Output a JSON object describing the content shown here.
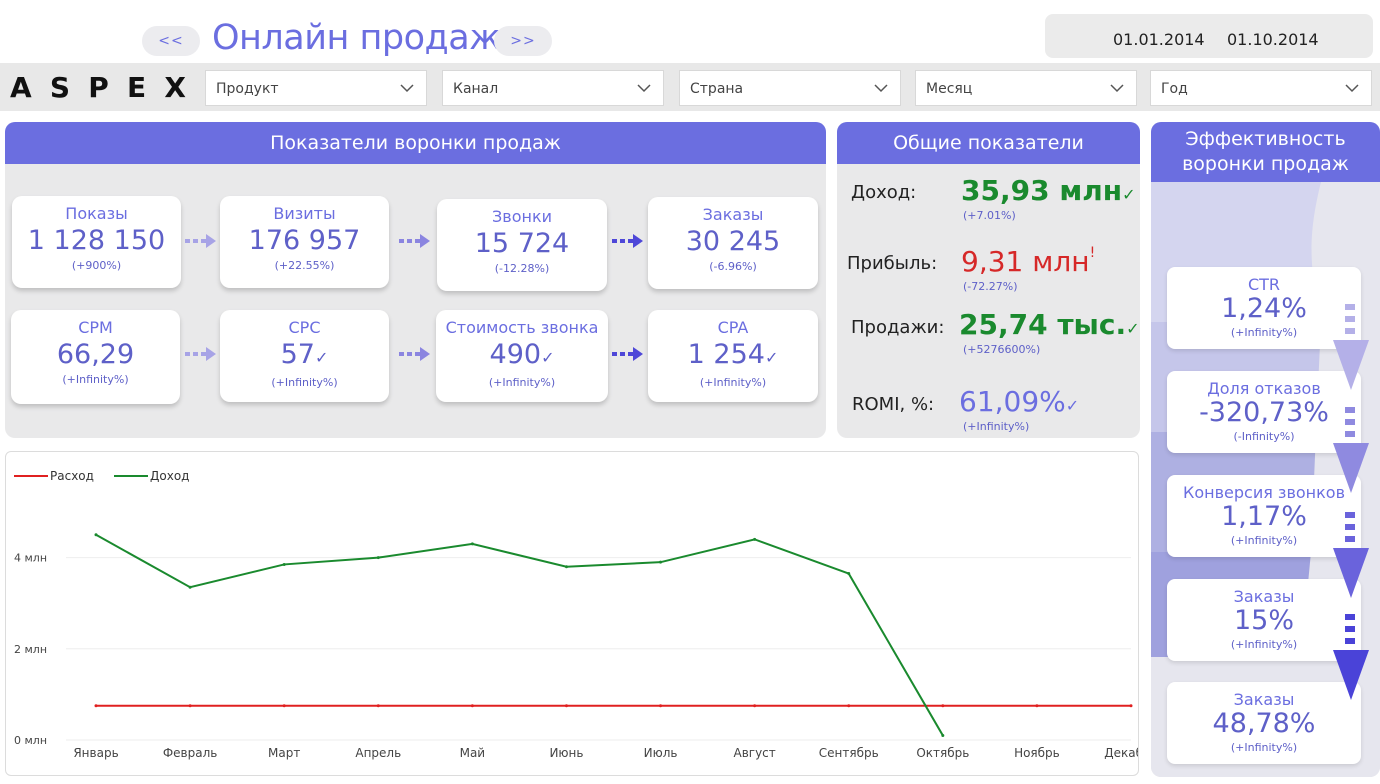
{
  "header": {
    "prev_label": "<<",
    "next_label": ">>",
    "title": "Онлайн продажи",
    "date_from": "01.01.2014",
    "date_to": "01.10.2014",
    "logo_text": "ASPEX"
  },
  "filters": [
    {
      "label": "Продукт"
    },
    {
      "label": "Канал"
    },
    {
      "label": "Страна"
    },
    {
      "label": "Месяц"
    },
    {
      "label": "Год"
    }
  ],
  "funnel": {
    "title": "Показатели воронки продаж",
    "cards": [
      {
        "label": "Показы",
        "value": "1 128 150",
        "change": "(+900%)"
      },
      {
        "label": "Визиты",
        "value": "176 957",
        "change": "(+22.55%)"
      },
      {
        "label": "Звонки",
        "value": "15 724",
        "change": "(-12.28%)"
      },
      {
        "label": "Заказы",
        "value": "30 245",
        "change": "(-6.96%)"
      },
      {
        "label": "CPM",
        "value": "66,29",
        "change": "(+Infinity%)"
      },
      {
        "label": "CPC",
        "value": "57",
        "change": "(+Infinity%)"
      },
      {
        "label": "Стоимость звонка",
        "value": "490",
        "change": "(+Infinity%)"
      },
      {
        "label": "CPA",
        "value": "1 254",
        "change": "(+Infinity%)"
      }
    ]
  },
  "general": {
    "title": "Общие показатели",
    "income_label": "Доход:",
    "income_value": "35,93 млн",
    "income_change": "(+7.01%)",
    "profit_label": "Прибыль:",
    "profit_value": "9,31 млн",
    "profit_change": "(-72.27%)",
    "sales_label": "Продажи:",
    "sales_value": "25,74 тыс.",
    "sales_change": "(+5276600%)",
    "romi_label": "ROMI, %:",
    "romi_value": "61,09%",
    "romi_change": "(+Infinity%)",
    "colors": {
      "good": "#1a8a2e",
      "bad": "#d62828",
      "neutral": "#6b6ee0"
    }
  },
  "efficiency": {
    "title": "Эффективность воронки продаж",
    "cards": [
      {
        "label": "CTR",
        "value": "1,24%",
        "change": "(+Infinity%)"
      },
      {
        "label": "Доля отказов",
        "value": "-320,73%",
        "change": "(-Infinity%)"
      },
      {
        "label": "Конверсия звонков",
        "value": "1,17%",
        "change": "(+Infinity%)"
      },
      {
        "label": "Заказы",
        "value": "15%",
        "change": "(+Infinity%)"
      },
      {
        "label": "Заказы",
        "value": "48,78%",
        "change": "(+Infinity%)"
      }
    ]
  },
  "chart_data": {
    "type": "line",
    "categories": [
      "Январь",
      "Февраль",
      "Март",
      "Апрель",
      "Май",
      "Июнь",
      "Июль",
      "Август",
      "Сентябрь",
      "Октябрь",
      "Ноябрь",
      "Декабрь"
    ],
    "series": [
      {
        "name": "Расход",
        "color": "#e02020",
        "values": [
          0.75,
          0.75,
          0.75,
          0.75,
          0.75,
          0.75,
          0.75,
          0.75,
          0.75,
          0.75,
          0.75,
          0.75
        ]
      },
      {
        "name": "Доход",
        "color": "#1a8a2e",
        "values": [
          4.5,
          3.35,
          3.85,
          4.0,
          4.3,
          3.8,
          3.9,
          4.4,
          3.65,
          0.1,
          null,
          null
        ]
      }
    ],
    "yticks": [
      "0 млн",
      "2 млн",
      "4 млн"
    ],
    "ytick_values": [
      0,
      2,
      4
    ],
    "ylim": [
      0,
      5
    ],
    "legend": "top-left",
    "grid": true
  }
}
